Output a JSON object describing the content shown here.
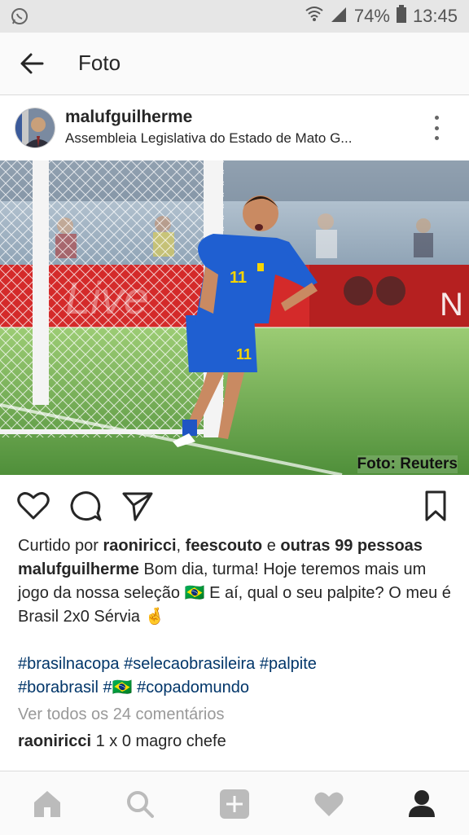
{
  "status_bar": {
    "battery": "74%",
    "time": "13:45",
    "icons": [
      "whatsapp-icon",
      "wifi-icon",
      "signal-icon",
      "battery-icon"
    ]
  },
  "app_bar": {
    "title": "Foto",
    "back_icon": "arrow-left-icon"
  },
  "post": {
    "username": "malufguilherme",
    "location": "Assembleia Legislativa do Estado de Mato G...",
    "photo_credit": "Foto: Reuters",
    "likes": {
      "prefix": "Curtido por",
      "user1": "raoniricci",
      "separator": ",",
      "user2": "feescouto",
      "conjunction": "e",
      "others": "outras 99 pessoas"
    },
    "caption": {
      "author": "malufguilherme",
      "text1": "Bom dia, turma! Hoje teremos mais um jogo da nossa seleção",
      "flag": "🇧🇷",
      "text2": "E aí, qual o seu palpite? O meu é Brasil 2x0 Sérvia",
      "gesture": "🤞"
    },
    "hashtags": {
      "line1": "#brasilnacopa #selecaobrasileira #palpite",
      "line2a": "#borabrasil #",
      "line2_flag": "🇧🇷",
      "line2b": " #copadomundo"
    },
    "view_comments": "Ver todos os 24 comentários",
    "comment": {
      "user": "raoniricci",
      "text": "1 x 0 magro chefe"
    }
  },
  "bottom_nav": [
    "home-icon",
    "search-icon",
    "add-icon",
    "heart-icon",
    "profile-icon"
  ],
  "colors": {
    "hashtag": "#003569",
    "muted": "#999999",
    "brazil_yellow": "#f5d400",
    "brazil_blue": "#1e64c8"
  }
}
